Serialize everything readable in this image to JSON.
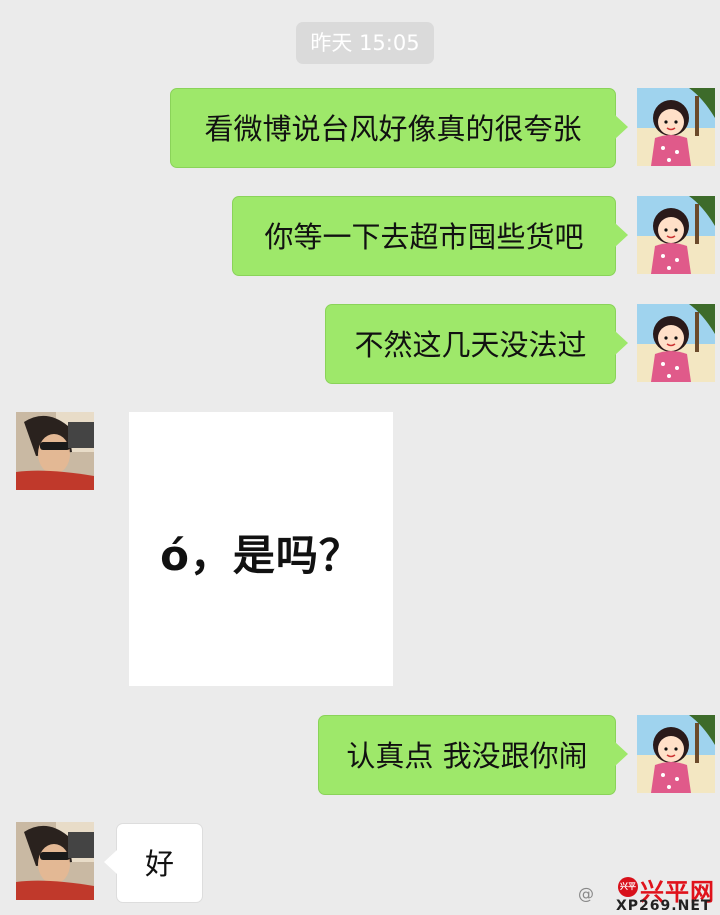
{
  "timestamp": "昨天 15:05",
  "messages": [
    {
      "side": "sent",
      "type": "text",
      "text": "看微博说台风好像真的很夸张"
    },
    {
      "side": "sent",
      "type": "text",
      "text": "你等一下去超市囤些货吧"
    },
    {
      "side": "sent",
      "type": "text",
      "text": "不然这几天没法过"
    },
    {
      "side": "received",
      "type": "sticker",
      "text": "ó，是吗？"
    },
    {
      "side": "sent",
      "type": "text",
      "text": "认真点 我没跟你闹"
    },
    {
      "side": "received",
      "type": "text",
      "text": "好"
    }
  ],
  "avatars": {
    "self": "cartoon-girl-avatar",
    "contact": "sunglasses-person-avatar"
  },
  "colors": {
    "background": "#ebebeb",
    "sent_bubble": "#9ee86a",
    "received_bubble": "#ffffff",
    "watermark_red": "#e0121b"
  },
  "watermark": {
    "logo_text": "兴平",
    "title": "兴平网",
    "url": "XP269.NET"
  }
}
